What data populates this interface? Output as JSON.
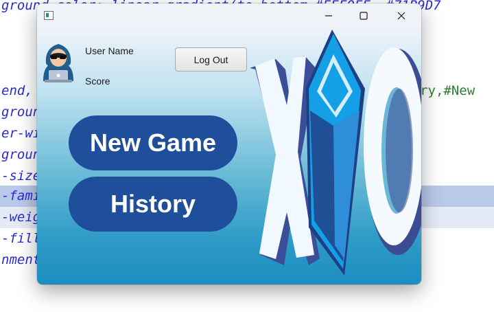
{
  "editor": {
    "lines": [
      {
        "code": "ground-color: linear-gradient(to bottom,#EEF0FF, #71B9D7",
        "rest": ""
      },
      {
        "code": "",
        "rest": ""
      },
      {
        "code": "",
        "rest": ""
      },
      {
        "code": "",
        "rest": ""
      },
      {
        "code": "end, ",
        "rest": "tory,#New"
      },
      {
        "code": "groun",
        "rest": ""
      },
      {
        "code": "er-wi",
        "rest": ""
      },
      {
        "code": "groun",
        "rest": ""
      },
      {
        "code": "-size",
        "rest": ""
      },
      {
        "code": "-fami",
        "rest": ""
      },
      {
        "code": "-weig",
        "rest": ""
      },
      {
        "code": "-fill",
        "rest": ""
      },
      {
        "code": "nment",
        "rest": ""
      }
    ]
  },
  "window": {
    "app_icon": "window-app-icon",
    "controls": {
      "minimize": "minimize-icon",
      "maximize": "maximize-icon",
      "close": "close-icon"
    }
  },
  "header": {
    "user_name_label": "User Name",
    "score_label": "Score",
    "logout_label": "Log Out",
    "avatar_icon": "hacker-avatar-icon"
  },
  "menu": {
    "new_game_label": "New Game",
    "history_label": "History"
  },
  "logo": {
    "icon": "xo-logo",
    "letters": "XO",
    "colors": {
      "x_face": "#f2f8ff",
      "x_side": "#3a4f97",
      "diamond": "#17a7e8",
      "diamond_dark": "#1d3f86",
      "o_face": "#f5faff",
      "o_side": "#3b4c92"
    }
  }
}
